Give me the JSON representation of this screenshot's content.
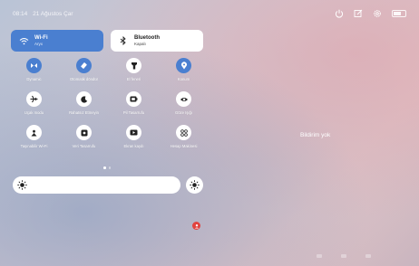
{
  "status": {
    "time": "08:14",
    "date": "21 Ağustos Çar"
  },
  "top_icons": [
    "power-icon",
    "edit-icon",
    "settings-icon",
    "battery-icon"
  ],
  "tiles_wide": [
    {
      "title": "Wi-Fi",
      "subtitle": "Aryx",
      "icon": "wifi-icon",
      "active": true
    },
    {
      "title": "Bluetooth",
      "subtitle": "Kapalı",
      "icon": "bluetooth-icon",
      "active": false
    }
  ],
  "toggles": [
    {
      "label": "Dynamic",
      "icon": "dynamic-icon",
      "active": true
    },
    {
      "label": "Otomatik döndür",
      "icon": "rotate-icon",
      "active": true
    },
    {
      "label": "El feneri",
      "icon": "flashlight-icon",
      "active": false
    },
    {
      "label": "Konum",
      "icon": "location-icon",
      "active": true
    },
    {
      "label": "Uçak modu",
      "icon": "airplane-icon",
      "active": false
    },
    {
      "label": "Rahatsız Etmeyin",
      "icon": "moon-icon",
      "active": false
    },
    {
      "label": "Pil Tasarrufu",
      "icon": "battery-saver-icon",
      "active": false
    },
    {
      "label": "Göze Işığı",
      "icon": "eye-icon",
      "active": false
    },
    {
      "label": "Taşınabilir Wi-Fi",
      "icon": "hotspot-icon",
      "active": false
    },
    {
      "label": "Veri Tasarrufu",
      "icon": "data-saver-icon",
      "active": false
    },
    {
      "label": "Ekran kaydı",
      "icon": "screen-record-icon",
      "active": false
    },
    {
      "label": "Hesap Makinesi",
      "icon": "calculator-icon",
      "active": false
    }
  ],
  "page_indicator": {
    "current": 1,
    "total": 2
  },
  "brightness": {
    "level": 1.0
  },
  "notifications": {
    "empty_text": "Bildirim yok"
  },
  "colors": {
    "accent": "#4a7fd0",
    "tile_off": "#ffffff",
    "user": "#e2433f"
  }
}
